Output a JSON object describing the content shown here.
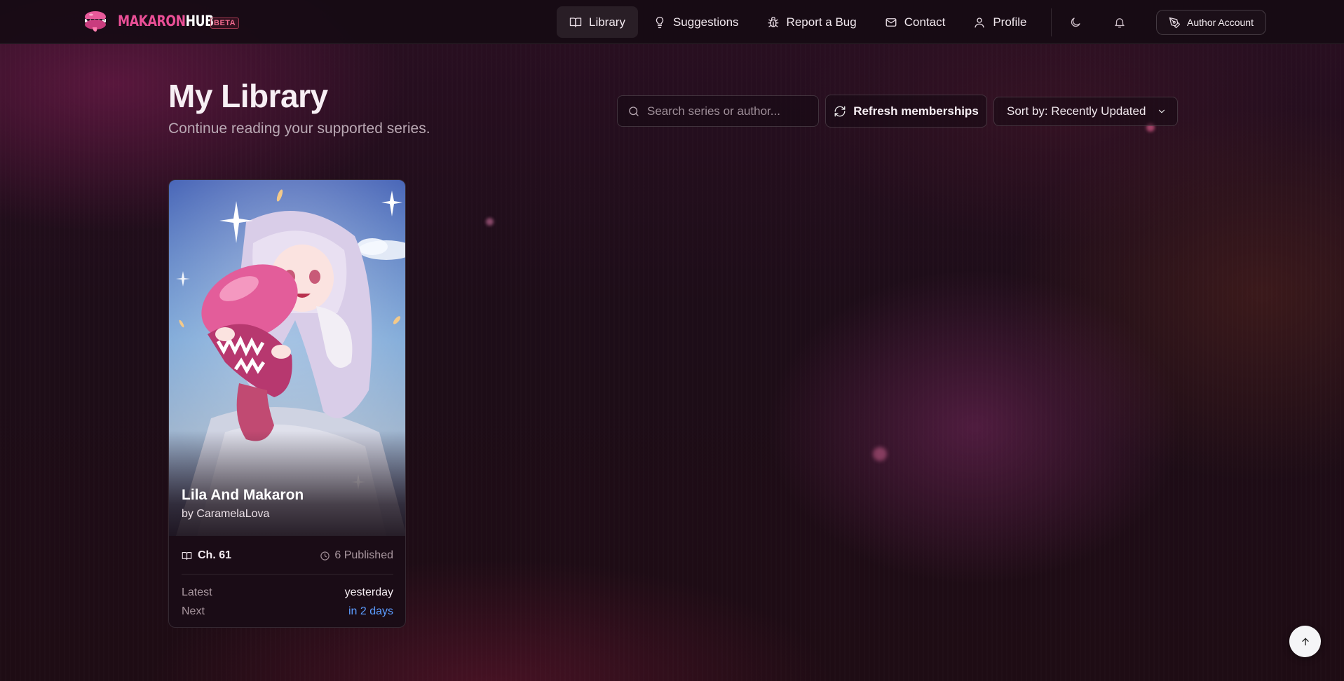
{
  "nav": {
    "brand": {
      "part1": "MAKARON",
      "part2": "HUB",
      "badge": "BETA"
    },
    "links": [
      {
        "label": "Library",
        "icon": "book-icon",
        "active": true
      },
      {
        "label": "Suggestions",
        "icon": "lightbulb-icon",
        "active": false
      },
      {
        "label": "Report a Bug",
        "icon": "bug-icon",
        "active": false
      },
      {
        "label": "Contact",
        "icon": "mail-icon",
        "active": false
      },
      {
        "label": "Profile",
        "icon": "user-icon",
        "active": false
      }
    ],
    "theme_icon": "moon-icon",
    "notifications_icon": "bell-icon",
    "author_account_label": "Author Account",
    "author_account_icon": "pen-tool-icon"
  },
  "header": {
    "title": "My Library",
    "subtitle": "Continue reading your supported series."
  },
  "controls": {
    "search_placeholder": "Search series or author...",
    "search_value": "",
    "refresh_label": "Refresh memberships",
    "sort_label": "Sort by: Recently Updated"
  },
  "library": {
    "items": [
      {
        "title": "Lila And Makaron",
        "author": "by CaramelaLova",
        "chapter": "Ch. 61",
        "published": "6 Published",
        "latest_label": "Latest",
        "latest_value": "yesterday",
        "next_label": "Next",
        "next_value": "in 2 days"
      }
    ]
  },
  "colors": {
    "brand_pink": "#ea4f96",
    "next_blue": "#5b9cff",
    "background": "#1d0d18"
  }
}
